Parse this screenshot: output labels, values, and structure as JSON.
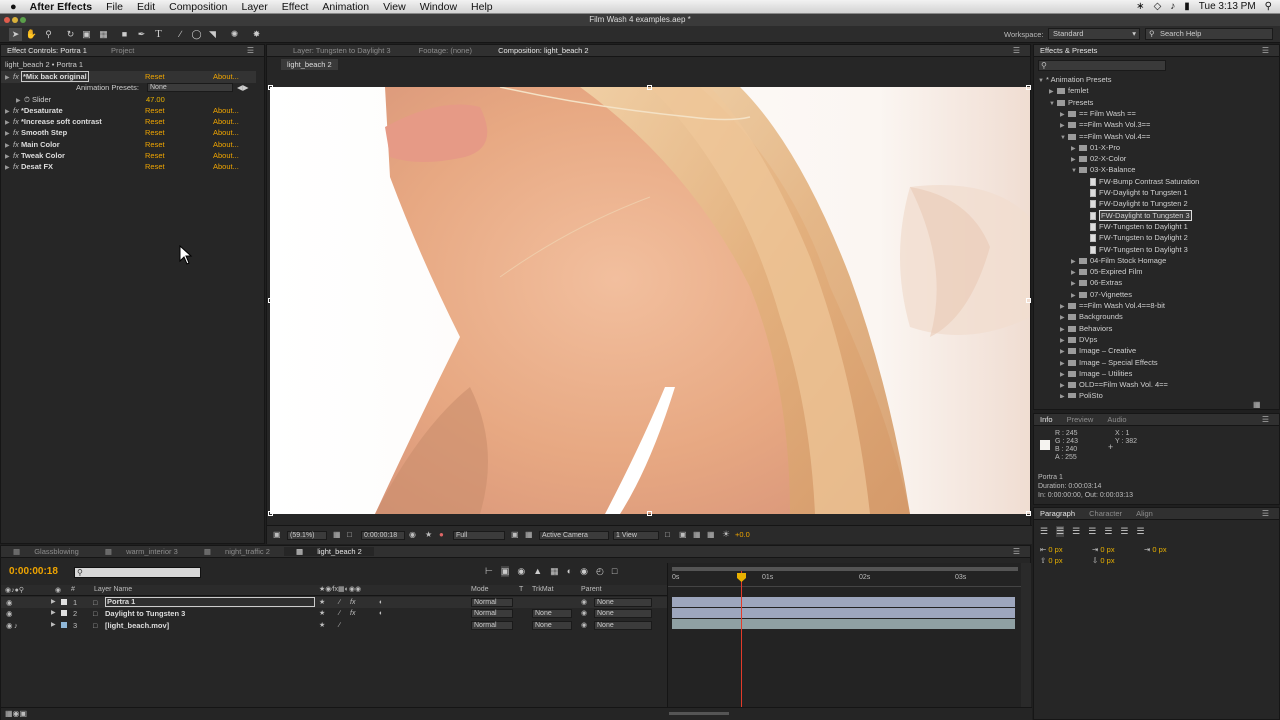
{
  "menubar": {
    "app": "After Effects",
    "items": [
      "File",
      "Edit",
      "Composition",
      "Layer",
      "Effect",
      "Animation",
      "View",
      "Window",
      "Help"
    ],
    "clock": "Tue 3:13 PM",
    "apple": ""
  },
  "window": {
    "title": "Film Wash 4 examples.aep *"
  },
  "toolbar": {
    "workspace_label": "Workspace:",
    "workspace_value": "Standard",
    "search_placeholder": "Search Help"
  },
  "effect_controls": {
    "tabs": [
      "Effect Controls: Portra 1",
      "Project"
    ],
    "header": "light_beach 2 • Portra 1",
    "effects": [
      {
        "name": "*Mix back original",
        "reset": "Reset",
        "about": "About..."
      },
      {
        "name": "*Desaturate",
        "reset": "Reset",
        "about": "About..."
      },
      {
        "name": "*Increase soft contrast",
        "reset": "Reset",
        "about": "About..."
      },
      {
        "name": "Smooth Step",
        "reset": "Reset",
        "about": "About..."
      },
      {
        "name": "Main Color",
        "reset": "Reset",
        "about": "About..."
      },
      {
        "name": "Tweak Color",
        "reset": "Reset",
        "about": "About..."
      },
      {
        "name": "Desat FX",
        "reset": "Reset",
        "about": "About..."
      }
    ],
    "anim_presets_label": "Animation Presets:",
    "anim_presets_value": "None",
    "slider_label": "Slider",
    "slider_value": "47.00",
    "fx": "fx"
  },
  "comp_viewer": {
    "tabs": [
      "Layer: Tungsten to Daylight 3",
      "Footage: (none)",
      "Composition: light_beach 2"
    ],
    "subtab": "light_beach 2",
    "zoom": "(59.1%)",
    "timecode": "0:00:00:18",
    "resolution": "Full",
    "camera": "Active Camera",
    "views": "1 View",
    "exposure": "+0.0"
  },
  "effects_presets": {
    "tab": "Effects & Presets",
    "tree": [
      {
        "label": "* Animation Presets",
        "level": 0,
        "type": "open"
      },
      {
        "label": "femlet",
        "level": 1,
        "type": "folder"
      },
      {
        "label": "Presets",
        "level": 1,
        "type": "folder-open"
      },
      {
        "label": "== Film Wash ==",
        "level": 2,
        "type": "folder"
      },
      {
        "label": "==Film Wash Vol.3==",
        "level": 2,
        "type": "folder"
      },
      {
        "label": "==Film Wash Vol.4==",
        "level": 2,
        "type": "folder-open"
      },
      {
        "label": "01-X-Pro",
        "level": 3,
        "type": "folder"
      },
      {
        "label": "02-X-Color",
        "level": 3,
        "type": "folder"
      },
      {
        "label": "03-X-Balance",
        "level": 3,
        "type": "folder-open"
      },
      {
        "label": "FW-Bump Contrast Saturation",
        "level": 4,
        "type": "preset"
      },
      {
        "label": "FW-Daylight to Tungsten 1",
        "level": 4,
        "type": "preset"
      },
      {
        "label": "FW-Daylight to Tungsten 2",
        "level": 4,
        "type": "preset"
      },
      {
        "label": "FW-Daylight to Tungsten 3",
        "level": 4,
        "type": "preset",
        "selected": true
      },
      {
        "label": "FW-Tungsten to Daylight 1",
        "level": 4,
        "type": "preset"
      },
      {
        "label": "FW-Tungsten to Daylight 2",
        "level": 4,
        "type": "preset"
      },
      {
        "label": "FW-Tungsten to Daylight 3",
        "level": 4,
        "type": "preset"
      },
      {
        "label": "04-Film Stock Homage",
        "level": 3,
        "type": "folder"
      },
      {
        "label": "05-Expired Film",
        "level": 3,
        "type": "folder"
      },
      {
        "label": "06-Extras",
        "level": 3,
        "type": "folder"
      },
      {
        "label": "07-Vignettes",
        "level": 3,
        "type": "folder"
      },
      {
        "label": "==Film Wash Vol.4==8-bit",
        "level": 2,
        "type": "folder"
      },
      {
        "label": "Backgrounds",
        "level": 2,
        "type": "folder"
      },
      {
        "label": "Behaviors",
        "level": 2,
        "type": "folder"
      },
      {
        "label": "DVps",
        "level": 2,
        "type": "folder"
      },
      {
        "label": "Image – Creative",
        "level": 2,
        "type": "folder"
      },
      {
        "label": "Image – Special Effects",
        "level": 2,
        "type": "folder"
      },
      {
        "label": "Image – Utilities",
        "level": 2,
        "type": "folder"
      },
      {
        "label": "OLD==Film Wash Vol. 4==",
        "level": 2,
        "type": "folder"
      },
      {
        "label": "PoliSto",
        "level": 2,
        "type": "folder"
      }
    ]
  },
  "info": {
    "tabs": [
      "Info",
      "Preview",
      "Audio"
    ],
    "r": "R : 245",
    "g": "G : 243",
    "b": "B : 240",
    "a": "A : 255",
    "x": "X : 1",
    "y": "Y : 382",
    "layer": "Portra 1",
    "duration": "Duration: 0:00:03:14",
    "inout": "In: 0:00:00:00, Out: 0:00:03:13"
  },
  "paragraph": {
    "tabs": [
      "Paragraph",
      "Character",
      "Align"
    ],
    "indent": [
      "0 px",
      "0 px",
      "0 px",
      "0 px",
      "0 px"
    ]
  },
  "timeline": {
    "tabs": [
      "Glassblowing",
      "warm_interior 3",
      "night_traffic 2",
      "light_beach 2"
    ],
    "timecode": "0:00:00:18",
    "col_layer": "Layer Name",
    "col_mode": "Mode",
    "col_t": "T",
    "col_trkmat": "TrkMat",
    "col_parent": "Parent",
    "ruler": [
      "0s",
      "01s",
      "02s",
      "03s"
    ],
    "layers": [
      {
        "num": "1",
        "name": "Portra 1",
        "mode": "Normal",
        "trkmat": "",
        "parent": "None",
        "color": "#e0e0e0"
      },
      {
        "num": "2",
        "name": "Daylight to Tungsten 3",
        "mode": "Normal",
        "trkmat": "None",
        "parent": "None",
        "color": "#e0e0e0"
      },
      {
        "num": "3",
        "name": "[light_beach.mov]",
        "mode": "Normal",
        "trkmat": "None",
        "parent": "None",
        "color": "#8fb7d8"
      }
    ]
  },
  "colors": {
    "accent": "#f0a500",
    "playhead": "#e23b2a",
    "bar": "#9da6bd"
  }
}
